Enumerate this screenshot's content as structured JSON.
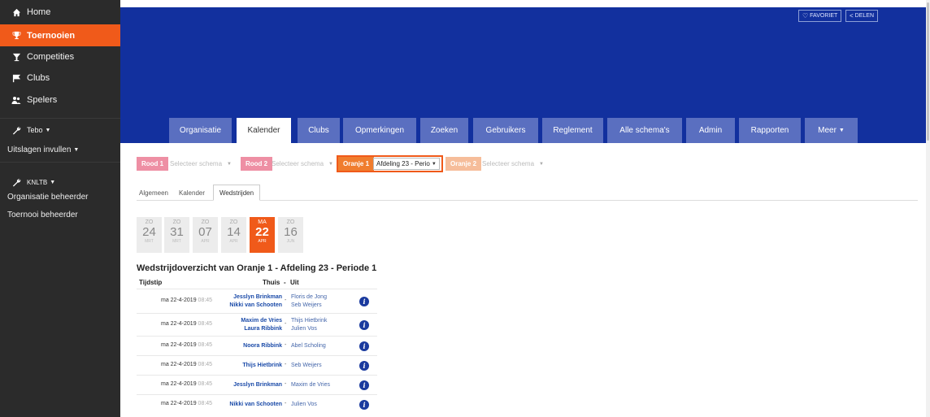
{
  "sidebar": {
    "items": [
      {
        "label": "Home",
        "icon": "home-icon"
      },
      {
        "label": "Toernooien",
        "icon": "trophy-icon"
      },
      {
        "label": "Competities",
        "icon": "cup-icon"
      },
      {
        "label": "Clubs",
        "icon": "flag-icon"
      },
      {
        "label": "Spelers",
        "icon": "players-icon"
      }
    ],
    "tebo": "Tebo",
    "uitslagen": "Uitslagen invullen",
    "knltb": "KNLTB",
    "org_beheerder": "Organisatie beheerder",
    "toernooi_beheerder": "Toernooi beheerder"
  },
  "header": {
    "favoriet": "FAVORIET",
    "delen": "DELEN",
    "accent": "#12309e"
  },
  "tabs": [
    "Organisatie",
    "Kalender",
    "Clubs",
    "Opmerkingen",
    "Zoeken",
    "Gebruikers",
    "Reglement",
    "Alle schema's",
    "Admin",
    "Rapporten",
    "Meer"
  ],
  "schedules": [
    {
      "label": "Rood 1",
      "select": "Selecteer schema",
      "color": "#ee8fa4"
    },
    {
      "label": "Rood 2",
      "select": "Selecteer schema",
      "color": "#ee8fa4"
    },
    {
      "label": "Oranje 1",
      "select": "Afdeling 23 - Perio",
      "color": "#f07d2e"
    },
    {
      "label": "Oranje 2",
      "select": "Selecteer schema",
      "color": "#f6bd9a"
    }
  ],
  "subtabs": [
    "Algemeen",
    "Kalender",
    "Wedstrijden"
  ],
  "dates": [
    {
      "day": "ZO",
      "num": "24",
      "mon": "MRT"
    },
    {
      "day": "ZO",
      "num": "31",
      "mon": "MRT"
    },
    {
      "day": "ZO",
      "num": "07",
      "mon": "APR"
    },
    {
      "day": "ZO",
      "num": "14",
      "mon": "APR"
    },
    {
      "day": "MA",
      "num": "22",
      "mon": "APR"
    },
    {
      "day": "ZO",
      "num": "16",
      "mon": "JUN"
    }
  ],
  "overview": {
    "title": "Wedstrijdoverzicht van Oranje 1 - Afdeling 23 - Periode 1",
    "col_time": "Tijdstip",
    "col_home": "Thuis",
    "col_sep": "-",
    "col_away": "Uit"
  },
  "matches": [
    {
      "date": "ma 22-4-2019",
      "time": "08:45",
      "home": [
        "Jesslyn Brinkman",
        "Nikki van Schooten"
      ],
      "away": [
        "Floris de Jong",
        "Seb Weijers"
      ]
    },
    {
      "date": "ma 22-4-2019",
      "time": "08:45",
      "home": [
        "Maxim de Vries",
        "Laura Ribbink"
      ],
      "away": [
        "Thijs Hietbrink",
        "Julien Vos"
      ]
    },
    {
      "date": "ma 22-4-2019",
      "time": "08:45",
      "home": [
        "Noora Ribbink"
      ],
      "away": [
        "Abel Scholing"
      ]
    },
    {
      "date": "ma 22-4-2019",
      "time": "08:45",
      "home": [
        "Thijs Hietbrink"
      ],
      "away": [
        "Seb Weijers"
      ]
    },
    {
      "date": "ma 22-4-2019",
      "time": "08:45",
      "home": [
        "Jesslyn Brinkman"
      ],
      "away": [
        "Maxim de Vries"
      ]
    },
    {
      "date": "ma 22-4-2019",
      "time": "08:45",
      "home": [
        "Nikki van Schooten"
      ],
      "away": [
        "Julien Vos"
      ]
    }
  ],
  "info_glyph": "i"
}
